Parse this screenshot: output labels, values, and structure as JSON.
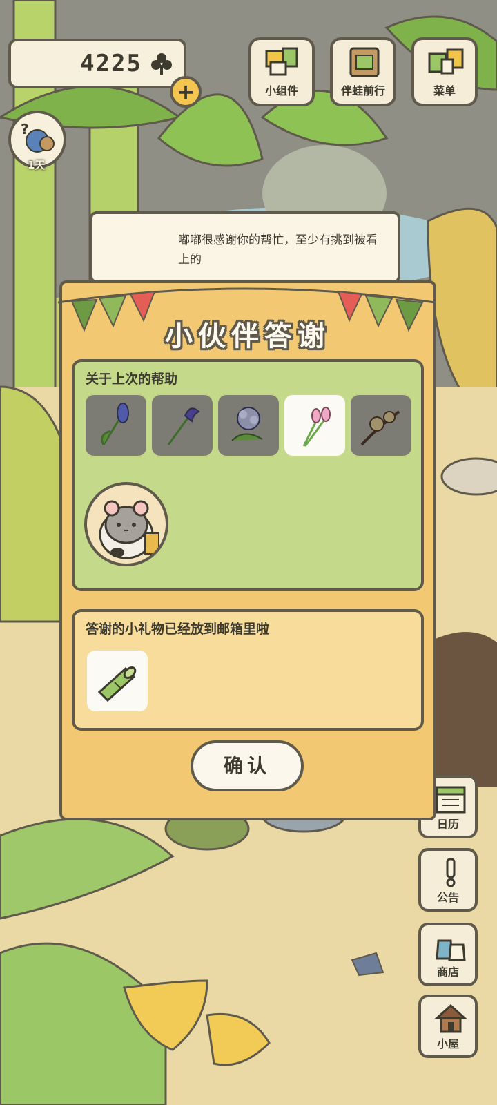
{
  "hud": {
    "clover_count": "4225",
    "days_label": "1天"
  },
  "top_buttons": [
    {
      "label": "小组件",
      "icon": "widget-icon"
    },
    {
      "label": "伴蛙前行",
      "icon": "frog-travel-icon"
    },
    {
      "label": "菜单",
      "icon": "menu-cards-icon"
    }
  ],
  "side_buttons": [
    {
      "label": "日历",
      "icon": "calendar-icon"
    },
    {
      "label": "公告",
      "icon": "notice-exclamation-icon"
    },
    {
      "label": "商店",
      "icon": "shop-bags-icon"
    },
    {
      "label": "小屋",
      "icon": "house-icon"
    }
  ],
  "dialog": {
    "title": "小伙伴答谢",
    "help_heading": "关于上次的帮助",
    "flowers": [
      "hyacinth",
      "iris",
      "lilac",
      "tulip",
      "plum-blossom"
    ],
    "selected_flower_index": 3,
    "message": "嘟嘟很感谢你的帮忙，至少有挑到被看上的",
    "gift_heading": "答谢的小礼物已经放到邮箱里啦",
    "gift_item": "bamboo",
    "confirm_label": "确认"
  },
  "colors": {
    "outline": "#5f5a4b",
    "dialog_bg": "#f2c872",
    "help_panel": "#c5d98a",
    "gift_panel": "#f8dc9b"
  }
}
